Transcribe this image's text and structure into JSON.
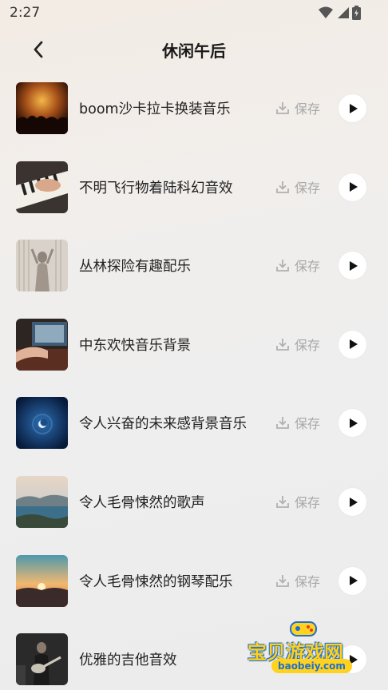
{
  "status_bar": {
    "time": "2:27"
  },
  "header": {
    "title": "休闲午后"
  },
  "save_label": "保存",
  "items": [
    {
      "title": "boom沙卡拉卡换装音乐",
      "thumb": "concert-crowd"
    },
    {
      "title": "不明飞行物着陆科幻音效",
      "thumb": "piano-hands"
    },
    {
      "title": "丛林探险有趣配乐",
      "thumb": "silhouette-curtain"
    },
    {
      "title": "中东欢快音乐背景",
      "thumb": "record-player"
    },
    {
      "title": "令人兴奋的未来感背景音乐",
      "thumb": "blue-moon"
    },
    {
      "title": "令人毛骨悚然的歌声",
      "thumb": "coastal-landscape"
    },
    {
      "title": "令人毛骨悚然的钢琴配乐",
      "thumb": "sunset-mountains"
    },
    {
      "title": "优雅的吉他音效",
      "thumb": "guitarist"
    }
  ],
  "watermark": {
    "text": "宝贝游戏网",
    "url": "baobeiy.com"
  }
}
